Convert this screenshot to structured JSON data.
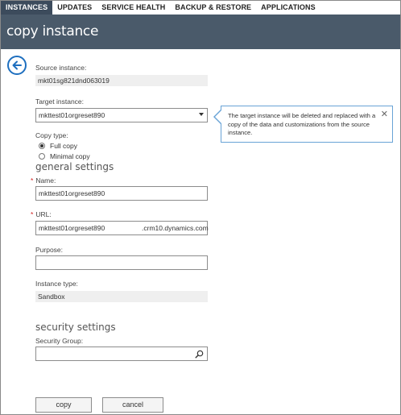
{
  "tabs": [
    {
      "label": "INSTANCES",
      "active": true
    },
    {
      "label": "UPDATES"
    },
    {
      "label": "SERVICE HEALTH"
    },
    {
      "label": "BACKUP & RESTORE"
    },
    {
      "label": "APPLICATIONS"
    }
  ],
  "page": {
    "title": "copy instance"
  },
  "form": {
    "source_label": "Source instance:",
    "source_value": "mkt01sg821dnd063019",
    "target_label": "Target instance:",
    "target_value": "mkttest01orgreset890",
    "copy_type_label": "Copy type:",
    "copy_full": "Full copy",
    "copy_minimal": "Minimal copy",
    "general_settings": "general settings",
    "required_mark": "*",
    "name_label": "Name:",
    "name_value": "mkttest01orgreset890",
    "url_label": "URL:",
    "url_value": "mkttest01orgreset890",
    "url_suffix": ".crm10.dynamics.com",
    "purpose_label": "Purpose:",
    "purpose_value": "",
    "instance_type_label": "Instance type:",
    "instance_type_value": "Sandbox",
    "security_settings": "security settings",
    "security_group_label": "Security Group:",
    "security_group_value": ""
  },
  "callout": {
    "text": "The target instance will be deleted and replaced with a copy of the data and customizations from the source instance.",
    "close_glyph": "✕"
  },
  "buttons": {
    "copy": "copy",
    "cancel": "cancel"
  },
  "colors": {
    "tab_active": "#3c4b5c",
    "titlebar": "#4a5a6a",
    "accent": "#1e6fbf",
    "required": "#d12020"
  }
}
